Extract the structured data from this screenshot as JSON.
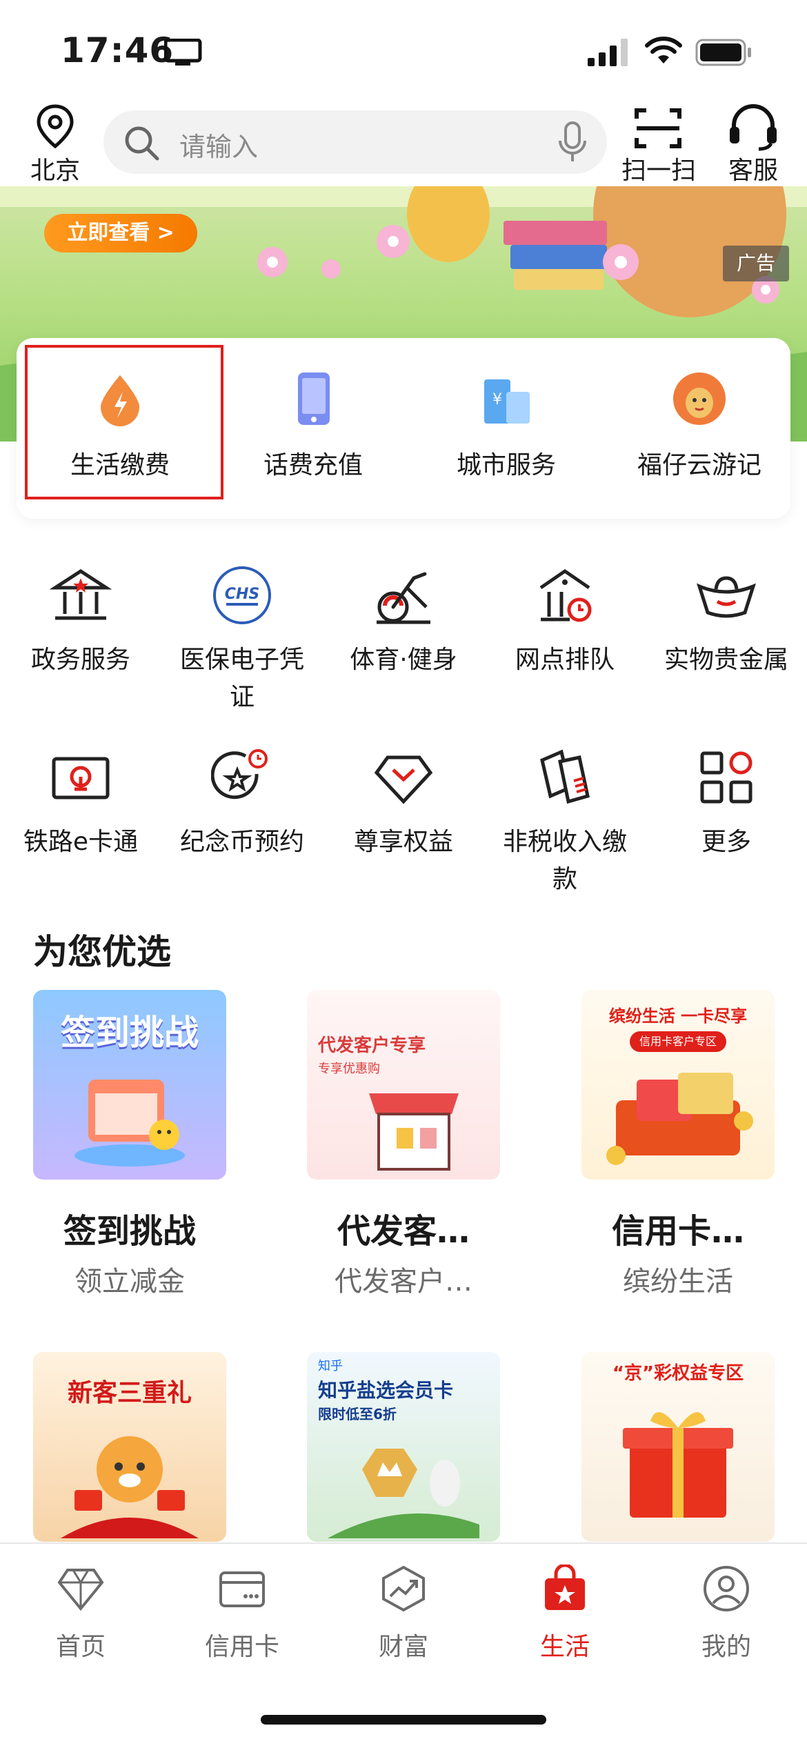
{
  "status_bar": {
    "time": "17:46"
  },
  "top_bar": {
    "location_label": "北京",
    "search_placeholder": "请输入",
    "scan_label": "扫一扫",
    "service_label": "客服"
  },
  "banner": {
    "cta_label": "立即查看 >",
    "ad_tag": "广告"
  },
  "features": [
    {
      "label": "生活缴费",
      "icon": "droplet-bolt-icon",
      "color": "#f28b3c"
    },
    {
      "label": "话费充值",
      "icon": "phone-icon",
      "color": "#7b8df2"
    },
    {
      "label": "城市服务",
      "icon": "building-icon",
      "color": "#5aa8f0"
    },
    {
      "label": "福仔云游记",
      "icon": "mascot-icon",
      "color": "#f07a3a"
    }
  ],
  "grid_row1": [
    {
      "label": "政务服务",
      "icon": "government-icon"
    },
    {
      "label": "医保电子凭证",
      "icon": "chs-icon"
    },
    {
      "label": "体育·健身",
      "icon": "exercise-bike-icon"
    },
    {
      "label": "网点排队",
      "icon": "branch-queue-icon"
    },
    {
      "label": "实物贵金属",
      "icon": "gold-ingot-icon"
    }
  ],
  "grid_row2": [
    {
      "label": "铁路e卡通",
      "icon": "railway-card-icon"
    },
    {
      "label": "纪念币预约",
      "icon": "coin-star-icon"
    },
    {
      "label": "尊享权益",
      "icon": "diamond-icon"
    },
    {
      "label": "非税收入缴款",
      "icon": "tax-docs-icon"
    },
    {
      "label": "更多",
      "icon": "more-grid-icon"
    }
  ],
  "section_title": "为您优选",
  "cards_row1": [
    {
      "title": "签到挑战",
      "subtitle": "领立减金",
      "image_text": "签到挑战"
    },
    {
      "title": "代发客…",
      "subtitle": "代发客户…",
      "image_text": "代发客户专享",
      "image_sub": "专享优惠购"
    },
    {
      "title": "信用卡…",
      "subtitle": "缤纷生活",
      "image_text": "缤纷生活 一卡尽享",
      "image_sub": "信用卡客户专区"
    }
  ],
  "cards_row2": [
    {
      "image_text": "新客三重礼"
    },
    {
      "image_text": "知乎盐选会员卡",
      "image_sub": "限时低至6折",
      "image_brand": "知乎"
    },
    {
      "image_text": "“京”彩权益专区"
    }
  ],
  "tabbar": [
    {
      "label": "首页",
      "icon": "diamond-home-icon",
      "active": false
    },
    {
      "label": "信用卡",
      "icon": "credit-card-icon",
      "active": false
    },
    {
      "label": "财富",
      "icon": "wealth-chart-icon",
      "active": false
    },
    {
      "label": "生活",
      "icon": "shopping-bag-star-icon",
      "active": true
    },
    {
      "label": "我的",
      "icon": "user-icon",
      "active": false
    }
  ],
  "colors": {
    "accent": "#e0201a",
    "highlight_box": "#e0201a",
    "text_primary": "#1a1a1a",
    "text_secondary": "#6b6b6b"
  }
}
